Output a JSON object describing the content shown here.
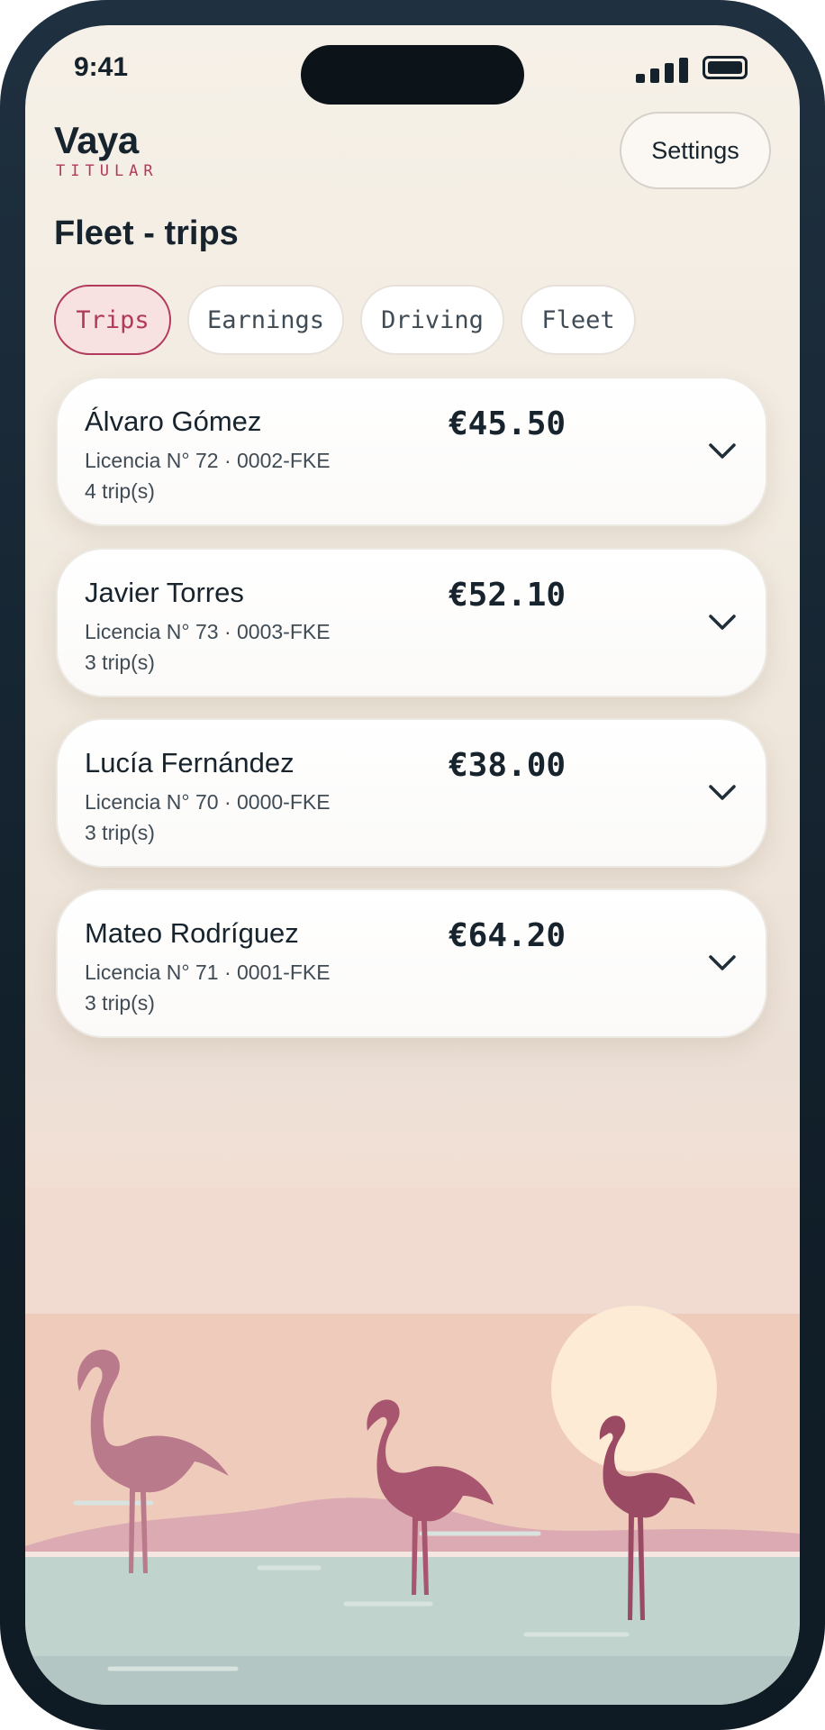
{
  "status": {
    "time": "9:41"
  },
  "app": {
    "name": "Vaya",
    "role": "TITULAR"
  },
  "header": {
    "settings_label": "Settings"
  },
  "page": {
    "title": "Fleet - trips"
  },
  "tabs": [
    {
      "label": "Trips",
      "active": true
    },
    {
      "label": "Earnings",
      "active": false
    },
    {
      "label": "Driving",
      "active": false
    },
    {
      "label": "Fleet",
      "active": false
    }
  ],
  "drivers": [
    {
      "name": "Álvaro Gómez",
      "license": "Licencia N° 72 · 0002-FKE",
      "trips": "4 trip(s)",
      "amount": "€45.50",
      "icon": "chevron-down-icon"
    },
    {
      "name": "Javier Torres",
      "license": "Licencia N° 73 · 0003-FKE",
      "trips": "3 trip(s)",
      "amount": "€52.10",
      "icon": "chevron-down-icon"
    },
    {
      "name": "Lucía Fernández",
      "license": "Licencia N° 70 · 0000-FKE",
      "trips": "3 trip(s)",
      "amount": "€38.00",
      "icon": "chevron-down-icon"
    },
    {
      "name": "Mateo Rodríguez",
      "license": "Licencia N° 71 · 0001-FKE",
      "trips": "3 trip(s)",
      "amount": "€64.20",
      "icon": "chevron-down-icon"
    }
  ],
  "colors": {
    "accent": "#b03a5b",
    "text": "#17232d",
    "flamingo": "#a8566f",
    "sun": "#fdebd6",
    "water": "#bfd2cc"
  }
}
